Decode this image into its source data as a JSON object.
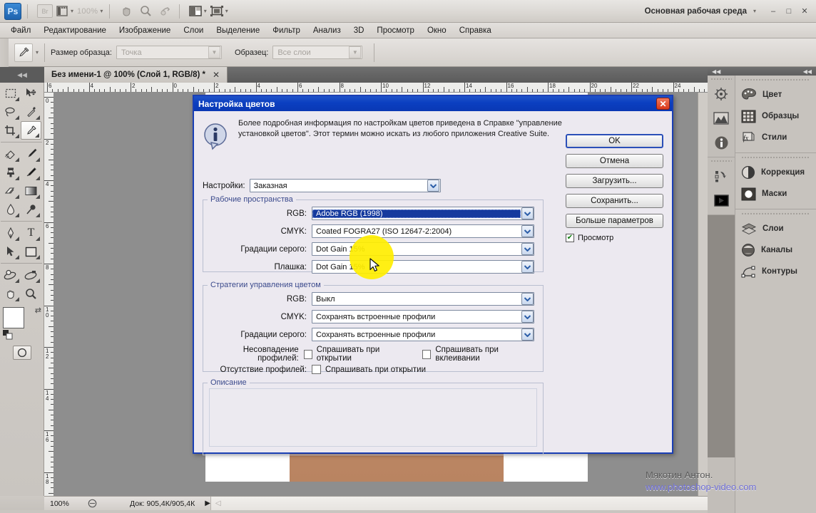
{
  "app": {
    "logo": "Ps",
    "workspace_label": "Основная рабочая среда",
    "workspace_caret": "▾",
    "zoom_field": "100%",
    "bridge_label": "Br",
    "minimize": "–",
    "maximize": "□",
    "close": "✕"
  },
  "menubar": {
    "items": [
      {
        "label": "Файл"
      },
      {
        "label": "Редактирование"
      },
      {
        "label": "Изображение"
      },
      {
        "label": "Слои"
      },
      {
        "label": "Выделение"
      },
      {
        "label": "Фильтр"
      },
      {
        "label": "Анализ"
      },
      {
        "label": "3D"
      },
      {
        "label": "Просмотр"
      },
      {
        "label": "Окно"
      },
      {
        "label": "Справка"
      }
    ]
  },
  "options_bar": {
    "tool_icon": "eyedropper-icon",
    "sample_size_label": "Размер образца:",
    "sample_size_value": "Точка",
    "sample_label": "Образец:",
    "sample_value": "Все слои"
  },
  "document": {
    "tab_title": "Без имени-1 @ 100% (Слой 1, RGB/8) *",
    "tab_close": "✕"
  },
  "rulers": {
    "horizontal_ticks": [
      "6",
      "4",
      "2",
      "0",
      "2",
      "4",
      "6",
      "8",
      "10",
      "12",
      "14",
      "16",
      "18",
      "20",
      "22",
      "24"
    ],
    "vertical_ticks": [
      "0",
      "2",
      "4",
      "6",
      "8",
      "10",
      "12",
      "14",
      "16",
      "18"
    ]
  },
  "status_bar": {
    "zoom": "100%",
    "doc_info": "Док: 905,4К/905,4К",
    "arrow": "▶"
  },
  "dock": {
    "collapse_left": "◀◀",
    "collapse_right": "◀◀",
    "icon_groups": [
      {
        "icons": [
          "navigator-icon",
          "histogram-icon",
          "info-icon"
        ]
      },
      {
        "icons": [
          "history-icon",
          "actions-icon"
        ]
      }
    ],
    "panel_groups": [
      {
        "panels": [
          {
            "icon": "palette-icon",
            "label": "Цвет"
          },
          {
            "icon": "swatches-icon",
            "label": "Образцы"
          },
          {
            "icon": "styles-fx-icon",
            "label": "Стили"
          }
        ]
      },
      {
        "panels": [
          {
            "icon": "adjustments-icon",
            "label": "Коррекция"
          },
          {
            "icon": "masks-icon",
            "label": "Маски"
          }
        ]
      },
      {
        "panels": [
          {
            "icon": "layers-icon",
            "label": "Слои"
          },
          {
            "icon": "channels-icon",
            "label": "Каналы"
          },
          {
            "icon": "paths-icon",
            "label": "Контуры"
          }
        ]
      }
    ]
  },
  "dialog": {
    "title": "Настройка цветов",
    "close_label": "✕",
    "info_icon": "info-balloon-icon",
    "info_text": "Более подробная информация по настройкам цветов приведена в Справке \"управление установкой цветов\". Этот термин можно искать из любого приложения Creative Suite.",
    "buttons": {
      "ok": "OK",
      "cancel": "Отмена",
      "load": "Загрузить...",
      "save": "Сохранить...",
      "more_options": "Больше параметров"
    },
    "preview": {
      "label": "Просмотр",
      "checked": true,
      "check_glyph": "✔"
    },
    "settings": {
      "label": "Настройки:",
      "value": "Заказная"
    },
    "working_spaces": {
      "legend": "Рабочие пространства",
      "rows": [
        {
          "label": "RGB:",
          "value": "Adobe RGB (1998)",
          "selected": true
        },
        {
          "label": "CMYK:",
          "value": "Coated FOGRA27 (ISO 12647-2:2004)",
          "selected": false
        },
        {
          "label": "Градации серого:",
          "value": "Dot Gain 15%",
          "selected": false
        },
        {
          "label": "Плашка:",
          "value": "Dot Gain 15%",
          "selected": false
        }
      ]
    },
    "policies": {
      "legend": "Стратегии управления цветом",
      "rows": [
        {
          "label": "RGB:",
          "value": "Выкл"
        },
        {
          "label": "CMYK:",
          "value": "Сохранять встроенные профили"
        },
        {
          "label": "Градации серого:",
          "value": "Сохранять встроенные профили"
        }
      ],
      "mismatch_label": "Несовпадение профилей:",
      "mismatch_checks": [
        {
          "label": "Спрашивать при открытии",
          "checked": false
        },
        {
          "label": "Спрашивать при вклеивании",
          "checked": false
        }
      ],
      "missing_label": "Отсутствие профилей:",
      "missing_checks": [
        {
          "label": "Спрашивать при открытии",
          "checked": false
        }
      ]
    },
    "description": {
      "legend": "Описание",
      "text": ""
    }
  },
  "watermark": {
    "name": "Мякотин Антон.",
    "url": "www.photoshop-video.com"
  },
  "colors": {
    "dialog_border": "#1a3fb5",
    "titlebar": "#0b3fc0",
    "selection": "#153a9e",
    "highlight": "#ffee00",
    "legend_text": "#3b4a8c"
  }
}
